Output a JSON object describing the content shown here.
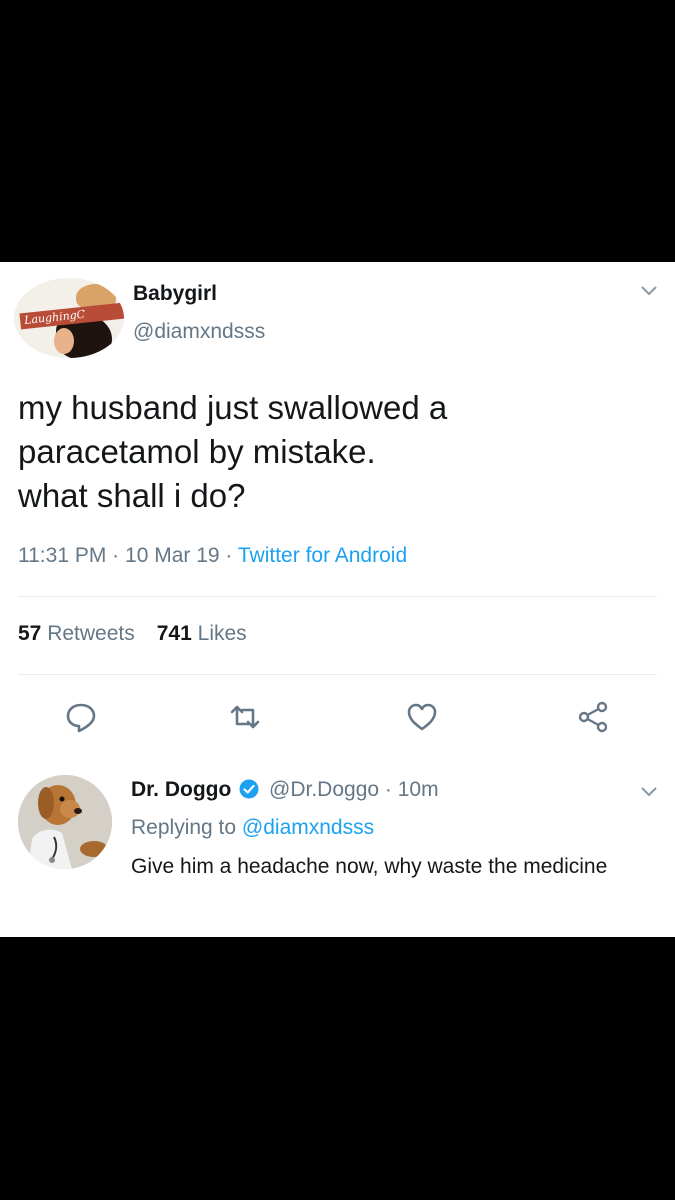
{
  "tweet": {
    "author_name": "Babygirl",
    "author_handle": "@diamxndsss",
    "avatar_tag_text": "LaughingC",
    "text_lines": [
      "my husband just swallowed a",
      "paracetamol by mistake.",
      "what shall i do?"
    ],
    "time": "11:31 PM",
    "date": "10 Mar 19",
    "separator": "·",
    "source": "Twitter for Android",
    "retweets_count": "57",
    "retweets_label": "Retweets",
    "likes_count": "741",
    "likes_label": "Likes"
  },
  "actions": [
    {
      "icon": "reply-icon"
    },
    {
      "icon": "retweet-icon"
    },
    {
      "icon": "like-icon"
    },
    {
      "icon": "share-icon"
    }
  ],
  "reply": {
    "author_name": "Dr. Doggo",
    "author_handle": "@Dr.Doggo",
    "separator": "·",
    "time_ago": "10m",
    "replying_to_label": "Replying to",
    "replying_to_handle": "@diamxndsss",
    "text": "Give him a headache now, why waste the medicine"
  },
  "colors": {
    "background": "#000000",
    "card": "#ffffff",
    "primary_text": "#14171a",
    "secondary_text": "#657786",
    "link": "#1da1f2",
    "icon": "#657786"
  }
}
